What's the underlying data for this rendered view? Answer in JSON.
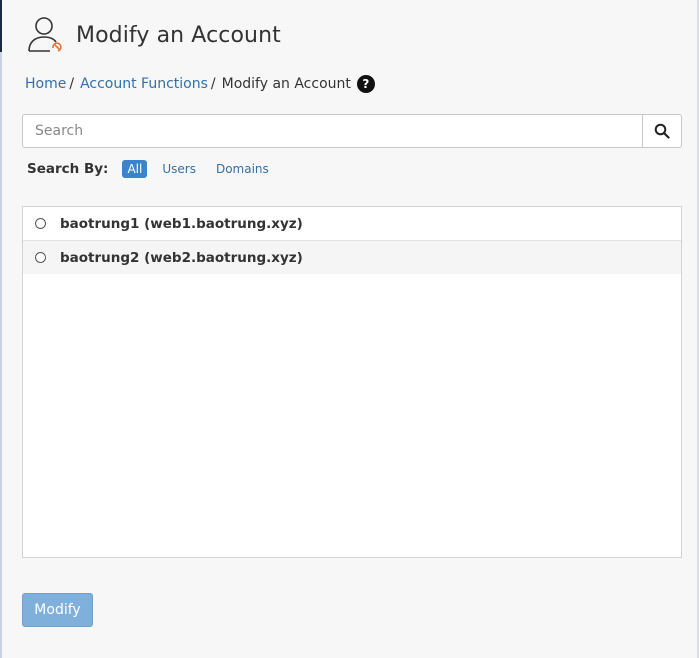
{
  "header": {
    "title": "Modify an Account",
    "icon": "user-edit-icon"
  },
  "breadcrumb": {
    "items": [
      {
        "label": "Home",
        "link": true
      },
      {
        "label": "Account Functions",
        "link": true
      },
      {
        "label": "Modify an Account",
        "link": false
      }
    ],
    "separator": "/",
    "help_icon": "question-circle-icon",
    "help_glyph": "?"
  },
  "search": {
    "placeholder": "Search",
    "value": "",
    "button_icon": "search-icon"
  },
  "search_by": {
    "label": "Search By:",
    "options": [
      "All",
      "Users",
      "Domains"
    ],
    "selected": "All"
  },
  "accounts": [
    {
      "label": "baotrung1 (web1.baotrung.xyz)",
      "selected": false
    },
    {
      "label": "baotrung2 (web2.baotrung.xyz)",
      "selected": false
    }
  ],
  "actions": {
    "modify_label": "Modify",
    "modify_disabled": true
  },
  "colors": {
    "link": "#3071a9",
    "active_filter": "#3a84c9",
    "button_disabled": "#7fb0dc",
    "icon_accent": "#e8743b"
  }
}
